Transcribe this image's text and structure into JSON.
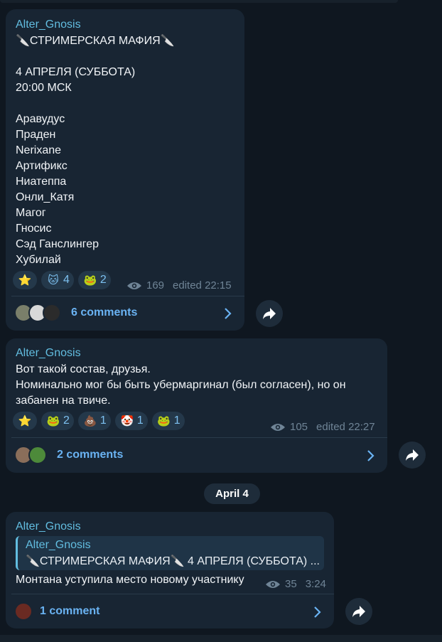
{
  "colors": {
    "bg": "#0f1720",
    "bubble": "#182533",
    "accent": "#62bde0",
    "link": "#6ab3f3"
  },
  "messages": [
    {
      "author": "Alter_Gnosis",
      "text": "🔪СТРИМЕРСКАЯ МАФИЯ🔪\n\n4 АПРЕЛЯ (СУББОТА)\n20:00 МСК\n\nАравудус\nПраден\nNerixane\nАртификс\nНиатеппа\nОнли_Катя\nМагог\nГносис\nСэд Ганслингер\nХубилай",
      "reactions": [
        {
          "icon": "star-icon",
          "emoji": "⭐",
          "count": ""
        },
        {
          "icon": "cat-icon",
          "emoji": "🐱",
          "count": "4"
        },
        {
          "icon": "frog-question-icon",
          "emoji": "🐸",
          "count": "2"
        }
      ],
      "views": "169",
      "time": "edited 22:15",
      "comments": "6 comments"
    },
    {
      "author": "Alter_Gnosis",
      "text": "Вот такой состав, друзья.\nНоминально мог бы быть убермаргинал (был согласен), но он\nзабанен на твиче.",
      "reactions": [
        {
          "icon": "star-icon",
          "emoji": "⭐",
          "count": ""
        },
        {
          "icon": "frog-icon",
          "emoji": "🐸",
          "count": "2"
        },
        {
          "icon": "poop-icon",
          "emoji": "💩",
          "count": "1"
        },
        {
          "icon": "clown-icon",
          "emoji": "🤡",
          "count": "1"
        },
        {
          "icon": "frog-party-icon",
          "emoji": "🐸",
          "count": "1"
        }
      ],
      "views": "105",
      "time": "edited 22:27",
      "comments": "2 comments"
    },
    {
      "author": "Alter_Gnosis",
      "quote": {
        "author": "Alter_Gnosis",
        "text": "🔪СТРИМЕРСКАЯ МАФИЯ🔪  4 АПРЕЛЯ (СУББОТА) ..."
      },
      "text": "Монтана уступила место новому участнику",
      "views": "35",
      "time": "3:24",
      "comments": "1 comment"
    }
  ],
  "date_separator": "April 4"
}
